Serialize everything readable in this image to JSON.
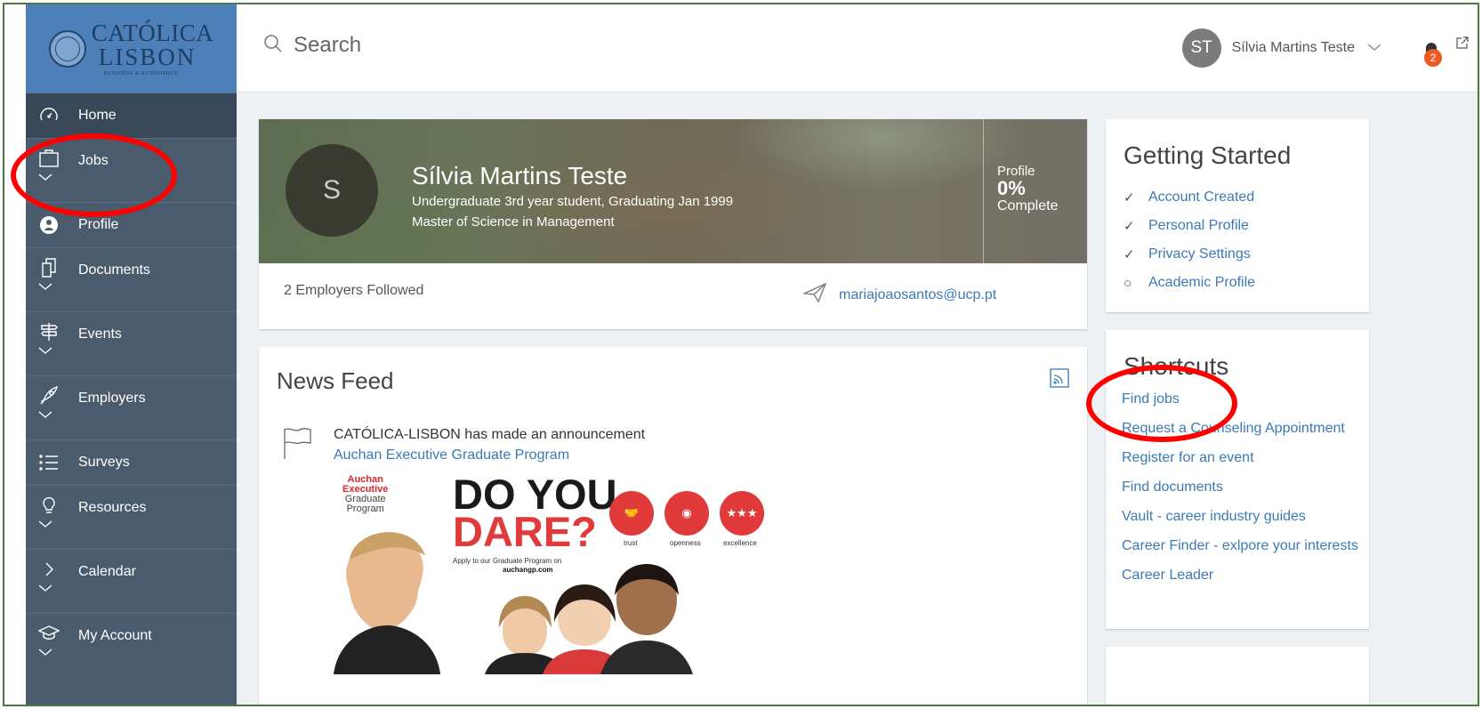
{
  "sidebar": {
    "logo_text": "CATÓLICA LISBON BUSINESS & ECONOMICS",
    "items": [
      {
        "label": "Home",
        "icon": "speedometer-icon"
      },
      {
        "label": "Jobs",
        "icon": "briefcase-icon"
      },
      {
        "label": "Profile",
        "icon": "person-icon"
      },
      {
        "label": "Documents",
        "icon": "documents-icon"
      },
      {
        "label": "Events",
        "icon": "signpost-icon"
      },
      {
        "label": "Employers",
        "icon": "rocket-icon"
      },
      {
        "label": "Surveys",
        "icon": "list-icon"
      },
      {
        "label": "Resources",
        "icon": "lightbulb-icon"
      },
      {
        "label": "Calendar",
        "icon": "chevron-right-icon"
      },
      {
        "label": "My Account",
        "icon": "graduation-cap-icon"
      }
    ]
  },
  "topbar": {
    "search_placeholder": "Search",
    "user_initials": "ST",
    "user_name": "Sílvia Martins Teste",
    "notification_count": "2"
  },
  "profile": {
    "initial": "S",
    "name": "Sílvia Martins Teste",
    "line1": "Undergraduate 3rd year student, Graduating Jan 1999",
    "line2": "Master of Science in Management",
    "completion_label": "Profile",
    "completion_value": "0%",
    "completion_suffix": "Complete",
    "employers_followed": "2  Employers Followed",
    "email": "mariajoaosantos@ucp.pt"
  },
  "news_feed": {
    "title": "News Feed",
    "announcement": "CATÓLICA-LISBON has made an announcement",
    "link": "Auchan Executive Graduate Program",
    "poster": {
      "brand1": "Auchan",
      "brand2": "Executive",
      "brand3": "Graduate",
      "brand4": "Program",
      "headline1": "DO YOU",
      "headline2": "DARE?",
      "value1": "trust",
      "value2": "openness",
      "value3": "excellence",
      "apply": "Apply to our Graduate Program on",
      "url": "auchangp.com"
    }
  },
  "getting_started": {
    "title": "Getting Started",
    "items": [
      {
        "label": "Account Created",
        "status": "✓"
      },
      {
        "label": "Personal Profile",
        "status": "✓"
      },
      {
        "label": "Privacy Settings",
        "status": "✓"
      },
      {
        "label": "Academic Profile",
        "status": "○"
      }
    ]
  },
  "shortcuts": {
    "title": "Shortcuts",
    "items": [
      "Find jobs",
      "Request a Counseling Appointment",
      "Register for an event",
      "Find documents",
      "Vault - career industry guides",
      "Career Finder - exlpore your interests",
      "Career Leader"
    ]
  },
  "colors": {
    "sidebar": "#4a5b6d",
    "logo_bg": "#4d7fb8",
    "link": "#3b7ab5",
    "badge": "#ec5a24",
    "annotation": "#ff0000"
  }
}
